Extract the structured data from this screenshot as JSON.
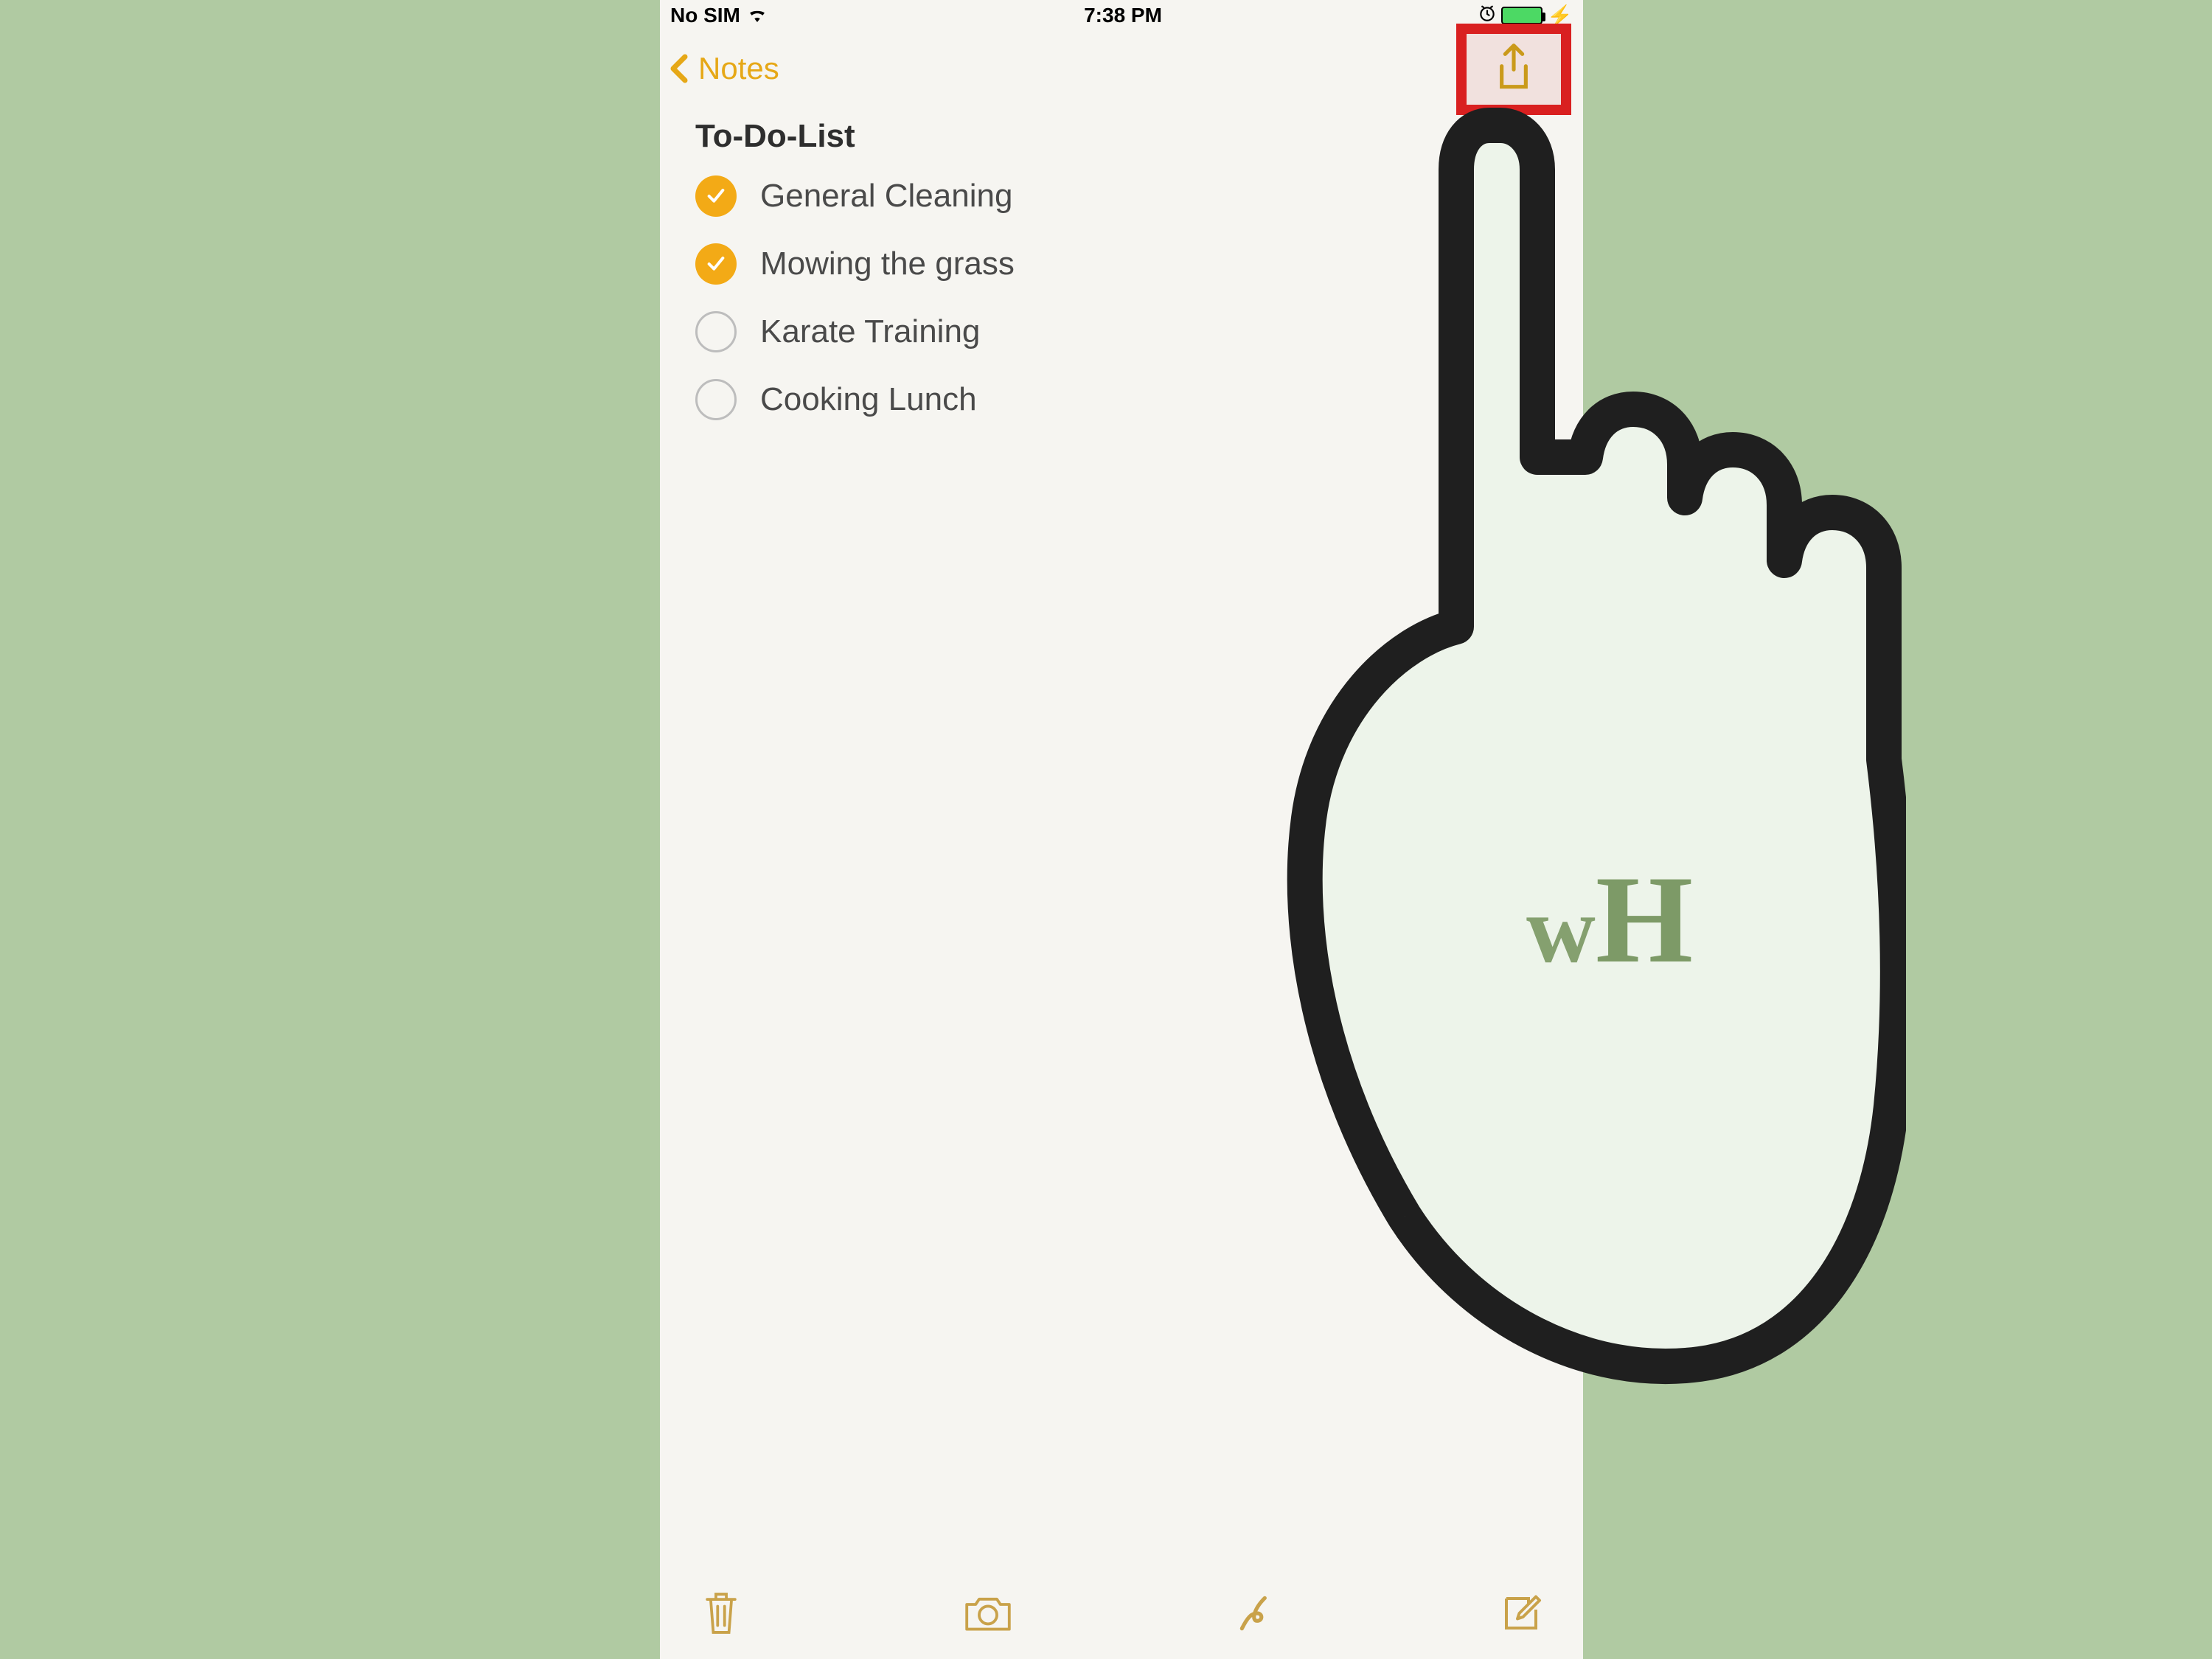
{
  "status_bar": {
    "carrier": "No SIM",
    "time": "7:38 PM",
    "charging_glyph": "⚡",
    "wifi_icon": "wifi-icon",
    "alarm_icon": "alarm-icon",
    "battery_icon": "battery-icon"
  },
  "nav": {
    "back_label": "Notes",
    "share_icon": "share-icon"
  },
  "note": {
    "title": "To-Do-List",
    "items": [
      {
        "label": "General Cleaning",
        "checked": true
      },
      {
        "label": "Mowing the grass",
        "checked": true
      },
      {
        "label": "Karate Training",
        "checked": false
      },
      {
        "label": "Cooking Lunch",
        "checked": false
      }
    ]
  },
  "toolbar": {
    "trash_icon": "trash-icon",
    "camera_icon": "camera-icon",
    "sketch_icon": "sketch-icon",
    "compose_icon": "compose-icon"
  },
  "overlay": {
    "logo_w": "w",
    "logo_h": "H"
  },
  "colors": {
    "background": "#b0caa2",
    "note_bg": "#f6f5f1",
    "accent": "#e6a817",
    "check_fill": "#f3aa16",
    "highlight_border": "#d92020"
  }
}
